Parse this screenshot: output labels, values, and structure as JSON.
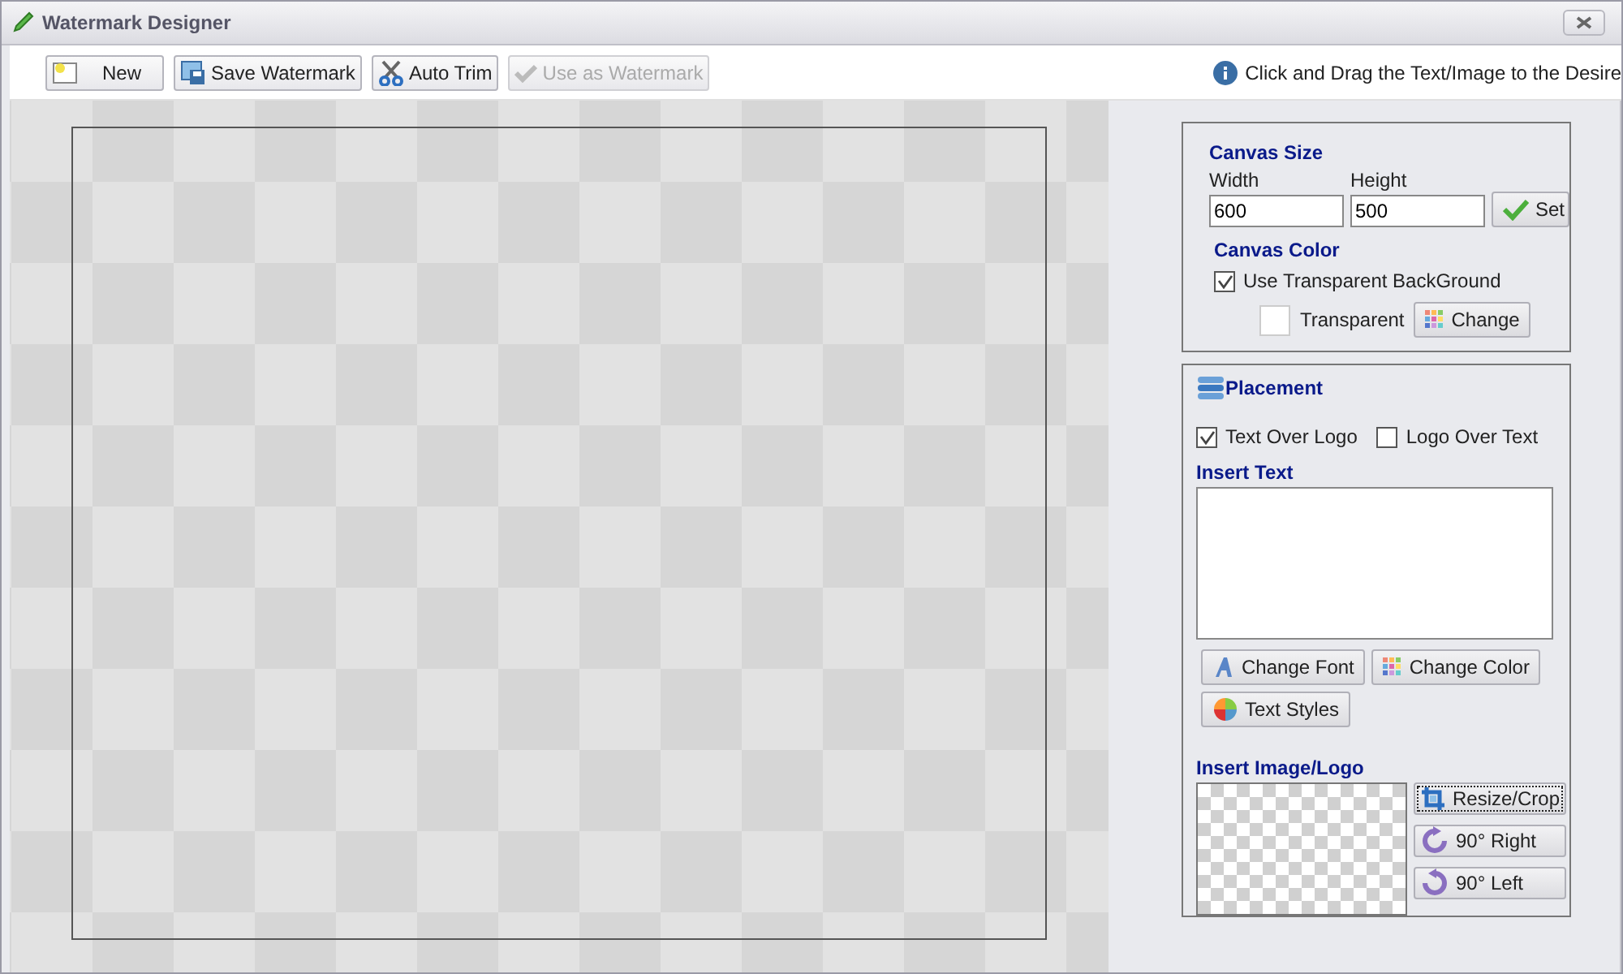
{
  "window": {
    "title": "Watermark Designer"
  },
  "toolbar": {
    "buttons": [
      {
        "kind": "new",
        "label": "New",
        "disabled": false
      },
      {
        "kind": "save",
        "label": "Save Watermark",
        "disabled": false
      },
      {
        "kind": "trim",
        "label": "Auto Trim",
        "disabled": false
      },
      {
        "kind": "use",
        "label": "Use as Watermark",
        "disabled": true
      }
    ],
    "hint": "Click and Drag the Text/Image to the Desire"
  },
  "canvas_size": {
    "title": "Canvas Size",
    "width_label": "Width",
    "width_value": "600",
    "height_label": "Height",
    "height_value": "500",
    "set_button": "Set",
    "color_title": "Canvas Color",
    "transparent_option": {
      "label": "Use Transparent BackGround",
      "checked": true
    },
    "swatch_label": "Transparent",
    "change_button": "Change"
  },
  "placement": {
    "title": "Placement",
    "options": [
      {
        "label": "Text Over Logo",
        "checked": true
      },
      {
        "label": "Logo Over Text",
        "checked": false
      }
    ],
    "insert_text_title": "Insert Text",
    "text_buttons": [
      {
        "kind": "font",
        "label": "Change Font"
      },
      {
        "kind": "color",
        "label": "Change Color"
      },
      {
        "kind": "styles",
        "label": "Text Styles"
      }
    ],
    "insert_image_title": "Insert Image/Logo",
    "image_buttons": [
      {
        "kind": "crop",
        "label": "Resize/Crop"
      },
      {
        "kind": "right",
        "label": "90° Right"
      },
      {
        "kind": "left",
        "label": "90° Left"
      }
    ]
  }
}
